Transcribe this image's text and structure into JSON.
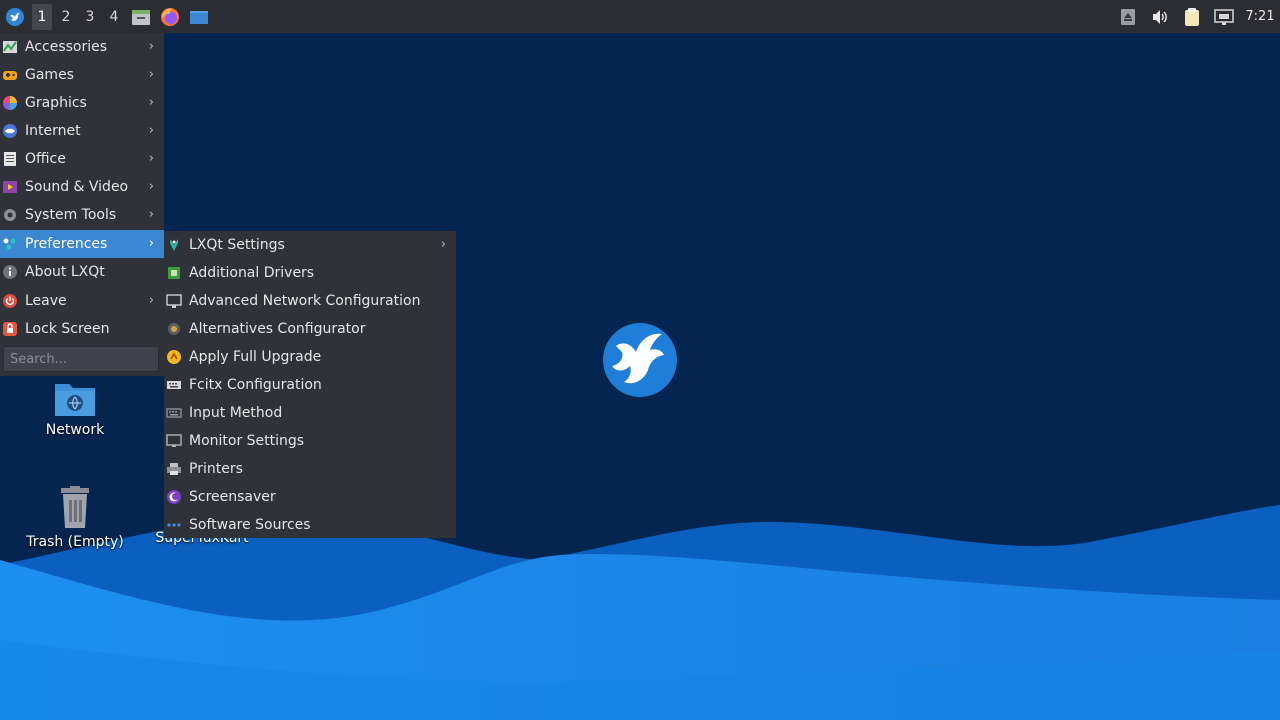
{
  "panel": {
    "desktops": [
      "1",
      "2",
      "3",
      "4"
    ],
    "active_desktop": "1",
    "clock": "7:21"
  },
  "main_menu": {
    "items": [
      {
        "label": "Accessories",
        "icon": "accessories-icon",
        "submenu": true
      },
      {
        "label": "Games",
        "icon": "games-icon",
        "submenu": true
      },
      {
        "label": "Graphics",
        "icon": "graphics-icon",
        "submenu": true
      },
      {
        "label": "Internet",
        "icon": "internet-icon",
        "submenu": true
      },
      {
        "label": "Office",
        "icon": "office-icon",
        "submenu": true
      },
      {
        "label": "Sound & Video",
        "icon": "sound-video-icon",
        "submenu": true
      },
      {
        "label": "System Tools",
        "icon": "system-tools-icon",
        "submenu": true
      },
      {
        "label": "Preferences",
        "icon": "preferences-icon",
        "submenu": true,
        "highlighted": true
      },
      {
        "label": "About LXQt",
        "icon": "about-icon",
        "submenu": false
      },
      {
        "label": "Leave",
        "icon": "leave-icon",
        "submenu": true
      },
      {
        "label": "Lock Screen",
        "icon": "lock-icon",
        "submenu": false
      }
    ],
    "search_placeholder": "Search..."
  },
  "preferences_menu": {
    "items": [
      {
        "label": "LXQt Settings",
        "icon": "lxqt-settings-icon",
        "submenu": true
      },
      {
        "label": "Additional Drivers",
        "icon": "drivers-icon",
        "submenu": false
      },
      {
        "label": "Advanced Network Configuration",
        "icon": "network-config-icon",
        "submenu": false
      },
      {
        "label": "Alternatives Configurator",
        "icon": "alternatives-icon",
        "submenu": false
      },
      {
        "label": "Apply Full Upgrade",
        "icon": "upgrade-icon",
        "submenu": false
      },
      {
        "label": "Fcitx Configuration",
        "icon": "keyboard-icon",
        "submenu": false
      },
      {
        "label": "Input Method",
        "icon": "keyboard-icon",
        "submenu": false
      },
      {
        "label": "Monitor Settings",
        "icon": "monitor-icon",
        "submenu": false
      },
      {
        "label": "Printers",
        "icon": "printer-icon",
        "submenu": false
      },
      {
        "label": "Screensaver",
        "icon": "screensaver-icon",
        "submenu": false
      },
      {
        "label": "Software Sources",
        "icon": "software-sources-icon",
        "submenu": false
      }
    ]
  },
  "desktop": {
    "icons": [
      {
        "label": "Network",
        "icon": "network-folder-icon"
      },
      {
        "label": "Trash (Empty)",
        "icon": "trash-icon"
      },
      {
        "label": "SuperTuxKart",
        "icon": "supertuxkart-icon"
      }
    ]
  },
  "colors": {
    "panel_bg": "#2c2d33",
    "menu_bg": "#30323a",
    "highlight": "#3b87d2",
    "wallpaper_dark": "#04254f",
    "wallpaper_light": "#1d8ef0"
  }
}
